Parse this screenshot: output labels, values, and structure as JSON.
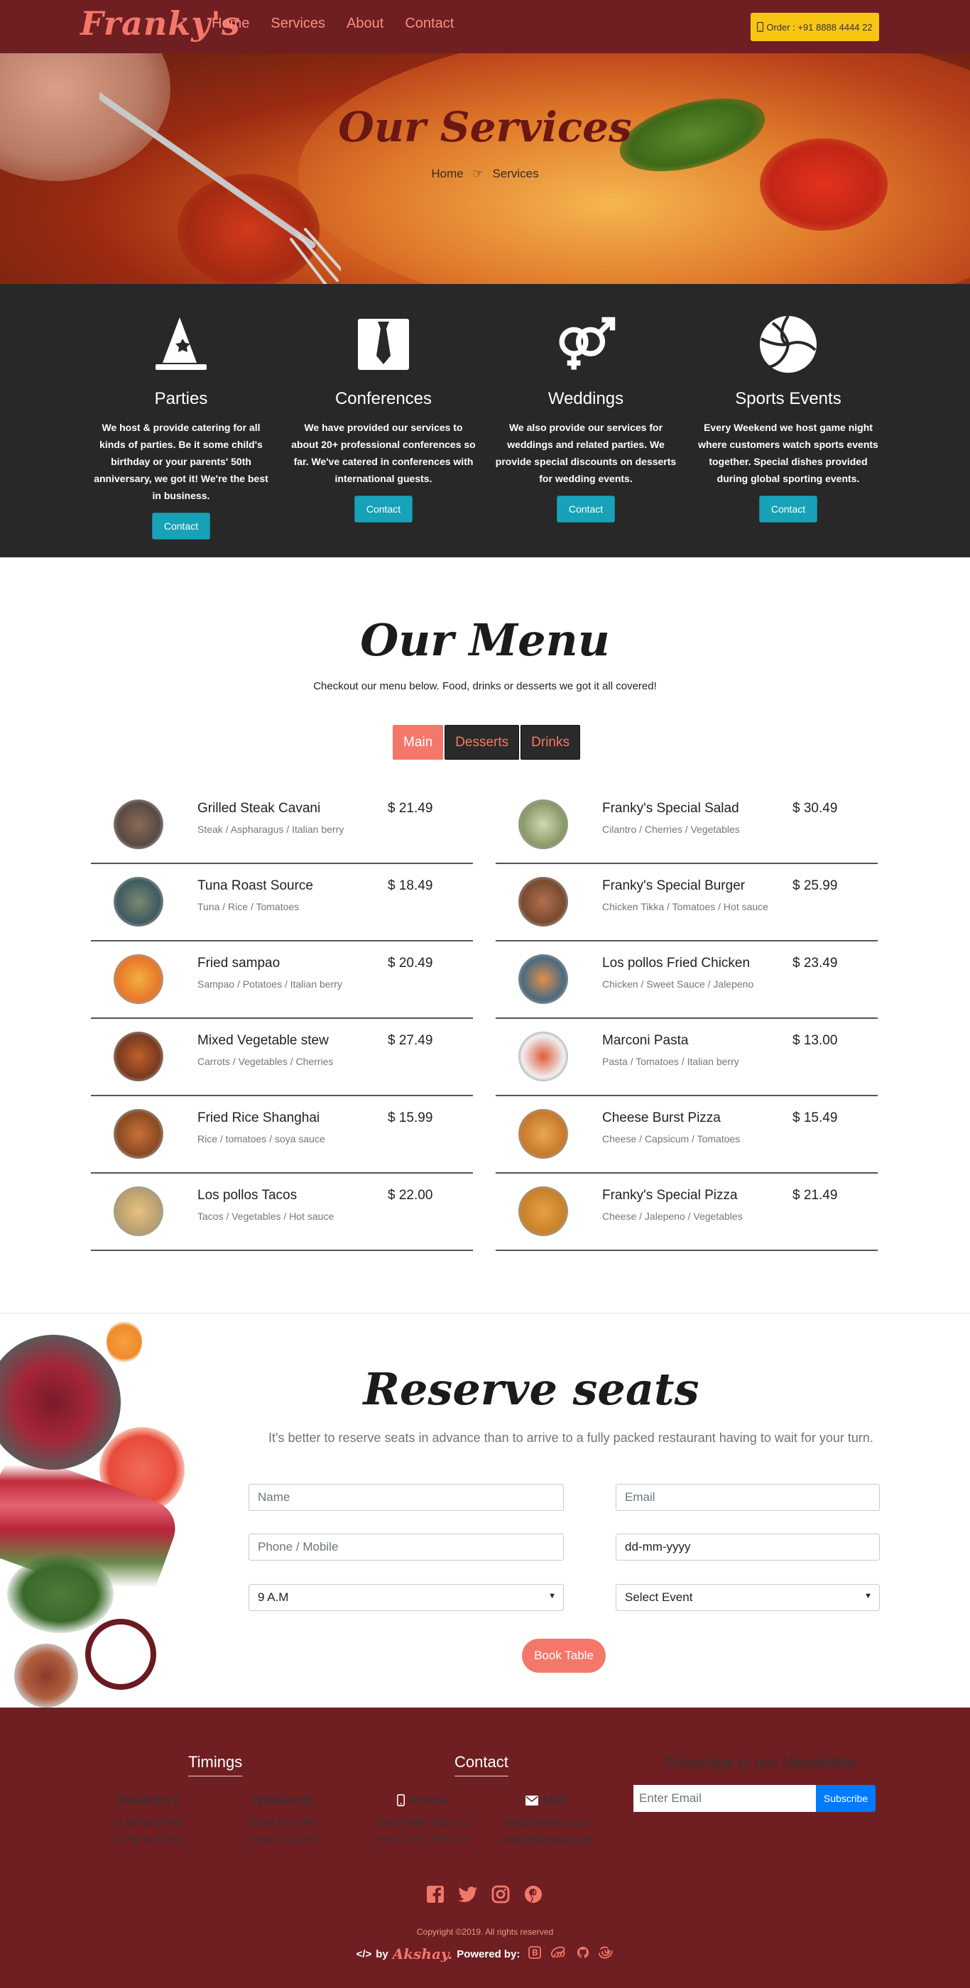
{
  "navbar": {
    "brand": "Franky's",
    "links": [
      "Home",
      "Services",
      "About",
      "Contact"
    ],
    "order_label": "Order : +91 8888 4444 22"
  },
  "hero": {
    "title": "Our Services",
    "breadcrumb_home": "Home",
    "breadcrumb_current": "Services"
  },
  "services": [
    {
      "title": "Parties",
      "icon": "wizard-hat-icon",
      "desc": "We host & provide catering for all kinds of parties. Be it some child's birthday or your parents' 50th anniversary, we got it! We're the best in business.",
      "button": "Contact"
    },
    {
      "title": "Conferences",
      "icon": "tie-icon",
      "desc": "We have provided our services to about 20+ professional conferences so far. We've catered in conferences with international guests.",
      "button": "Contact"
    },
    {
      "title": "Weddings",
      "icon": "venus-mars-icon",
      "desc": "We also provide our services for weddings and related parties. We provide special discounts on desserts for wedding events.",
      "button": "Contact"
    },
    {
      "title": "Sports Events",
      "icon": "volleyball-icon",
      "desc": "Every Weekend we host game night where customers watch sports events together. Special dishes provided during global sporting events.",
      "button": "Contact"
    }
  ],
  "menu": {
    "title": "Our Menu",
    "subtitle": "Checkout our menu below. Food, drinks or desserts we got it all covered!",
    "tabs": [
      {
        "label": "Main",
        "active": true
      },
      {
        "label": "Desserts",
        "active": false
      },
      {
        "label": "Drinks",
        "active": false
      }
    ],
    "left": [
      {
        "name": "Grilled Steak Cavani",
        "ingredients": "Steak / Aspharagus / Italian berry",
        "price": "$ 21.49"
      },
      {
        "name": "Tuna Roast Source",
        "ingredients": "Tuna / Rice / Tomatoes",
        "price": "$ 18.49"
      },
      {
        "name": "Fried sampao",
        "ingredients": "Sampao / Potatoes / Italian berry",
        "price": "$ 20.49"
      },
      {
        "name": "Mixed Vegetable stew",
        "ingredients": "Carrots / Vegetables / Cherries",
        "price": "$ 27.49"
      },
      {
        "name": "Fried Rice Shanghai",
        "ingredients": "Rice / tomatoes / soya sauce",
        "price": "$ 15.99"
      },
      {
        "name": "Los pollos Tacos",
        "ingredients": "Tacos / Vegetables / Hot sauce",
        "price": "$ 22.00"
      }
    ],
    "right": [
      {
        "name": "Franky's Special Salad",
        "ingredients": "Cilantro / Cherries / Vegetables",
        "price": "$ 30.49"
      },
      {
        "name": "Franky's Special Burger",
        "ingredients": "Chicken Tikka / Tomatoes / Hot sauce",
        "price": "$ 25.99"
      },
      {
        "name": "Los pollos Fried Chicken",
        "ingredients": "Chicken / Sweet Sauce / Jalepeno",
        "price": "$ 23.49"
      },
      {
        "name": "Marconi Pasta",
        "ingredients": "Pasta / Tomatoes / Italian berry",
        "price": "$ 13.00"
      },
      {
        "name": "Cheese Burst Pizza",
        "ingredients": "Cheese / Capsicum / Tomatoes",
        "price": "$ 15.49"
      },
      {
        "name": "Franky's Special Pizza",
        "ingredients": "Cheese / Jalepeno / Vegetables",
        "price": "$ 21.49"
      }
    ]
  },
  "reserve": {
    "title": "Reserve seats",
    "subtitle": "It's better to reserve seats in advance than to arrive to a fully packed restaurant having to wait for your turn.",
    "name_placeholder": "Name",
    "email_placeholder": "Email",
    "phone_placeholder": "Phone / Mobile",
    "date_placeholder": "dd-mm-yyyy",
    "time_value": "9 A.M",
    "event_value": "Select Event",
    "book_label": "Book Table"
  },
  "footer": {
    "timings_title": "Timings",
    "weekdays_label": "Weekdays",
    "weekdays_1": "8 AM to 2 PM",
    "weekdays_2": "5 PM to 9 PM",
    "weekends_label": "Weekends",
    "weekends_1": "8 AM to 2 PM",
    "weekends_2": "5 PM to 11 PM",
    "contact_title": "Contact",
    "phone_label": "Phone",
    "phone_1": "(+91) 8484 2424 11",
    "phone_2": "(+91) 7272 2727 22",
    "mail_label": "Mail",
    "mail_1": "info@frankys.com",
    "mail_2": "order@frankys.com",
    "newsletter_title": "Subscribe to our Newsletter",
    "newsletter_placeholder": "Enter Email",
    "subscribe_label": "Subscribe",
    "copyright": "Copyright ©2019. All rights reserved",
    "credit_by": "by",
    "credit_author": "Akshay.",
    "powered_by": "Powered by:"
  },
  "colors": {
    "maroon": "#6f1e22",
    "salmon": "#f3786a",
    "dark": "#282828",
    "teal": "#17a2b8",
    "yellow": "#f7c613"
  }
}
